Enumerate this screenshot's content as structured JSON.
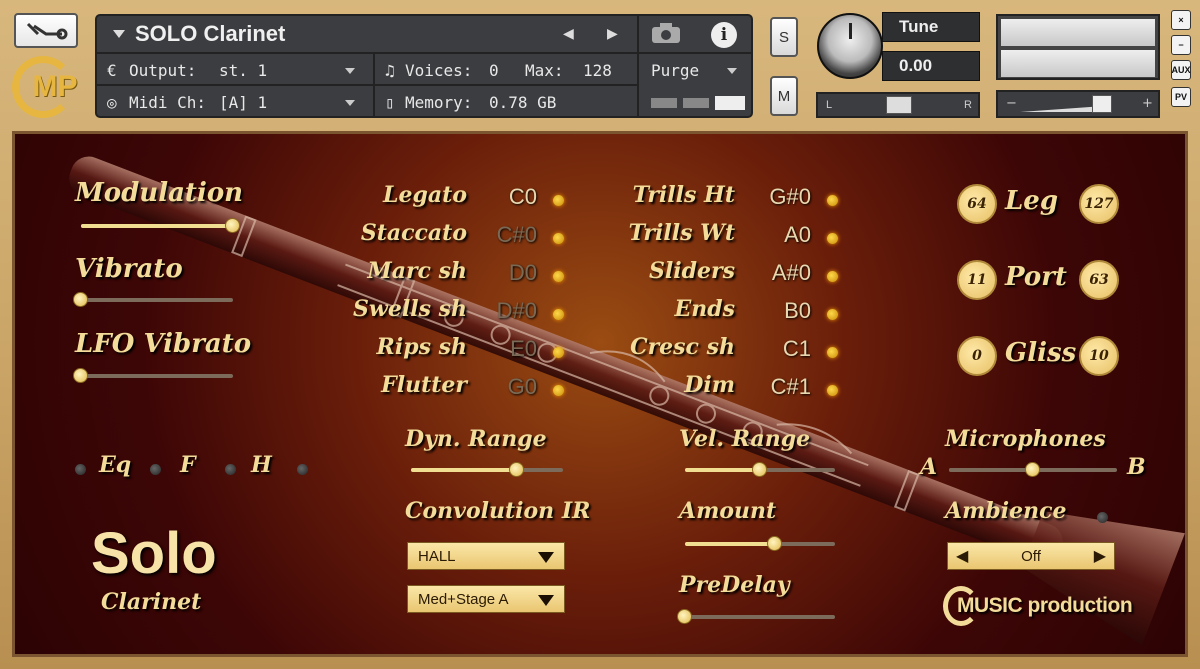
{
  "header": {
    "title": "SOLO Clarinet",
    "output_label": "Output:",
    "output_value": "st. 1",
    "voices_label": "Voices:",
    "voices_value": "0",
    "max_label": "Max:",
    "max_value": "128",
    "midi_label": "Midi Ch:",
    "midi_value": "[A] 1",
    "memory_label": "Memory:",
    "memory_value": "0.78 GB",
    "purge_label": "Purge",
    "s_label": "S",
    "m_label": "M",
    "tune_label": "Tune",
    "tune_value": "0.00",
    "pan_left": "L",
    "pan_right": "R",
    "vol_minus": "−",
    "vol_plus": "+",
    "side_buttons": [
      "×",
      "−",
      "AUX",
      "PV"
    ],
    "logo_text": "MP"
  },
  "controls": {
    "modulation": {
      "label": "Modulation",
      "value": 1.0
    },
    "vibrato": {
      "label": "Vibrato",
      "value": 0.0
    },
    "lfo_vibrato": {
      "label": "LFO Vibrato",
      "value": 0.0
    },
    "eq_labels": [
      "Eq",
      "F",
      "H"
    ],
    "dyn_range": {
      "label": "Dyn. Range",
      "value": 0.7
    },
    "vel_range": {
      "label": "Vel. Range",
      "value": 0.5
    },
    "convolution": {
      "label": "Convolution IR",
      "option1": "HALL",
      "option2": "Med+Stage A"
    },
    "amount": {
      "label": "Amount",
      "value": 0.6
    },
    "predelay": {
      "label": "PreDelay",
      "value": 0.0
    },
    "microphones": {
      "label": "Microphones",
      "a": "A",
      "b": "B",
      "value": 0.5
    },
    "ambience": {
      "label": "Ambience",
      "value": "Off"
    }
  },
  "keyswitches_left": [
    {
      "name": "Legato",
      "note": "C0"
    },
    {
      "name": "Staccato",
      "note": "C#0"
    },
    {
      "name": "Marc sh",
      "note": "D0"
    },
    {
      "name": "Swells sh",
      "note": "D#0"
    },
    {
      "name": "Rips sh",
      "note": "E0"
    },
    {
      "name": "Flutter",
      "note": "G0"
    }
  ],
  "keyswitches_right": [
    {
      "name": "Trills Ht",
      "note": "G#0"
    },
    {
      "name": "Trills Wt",
      "note": "A0"
    },
    {
      "name": "Sliders",
      "note": "A#0"
    },
    {
      "name": "Ends",
      "note": "B0"
    },
    {
      "name": "Cresc sh",
      "note": "C1"
    },
    {
      "name": "Dim",
      "note": "C#1"
    }
  ],
  "ranges": [
    {
      "label": "Leg",
      "low": "64",
      "high": "127"
    },
    {
      "label": "Port",
      "low": "11",
      "high": "63"
    },
    {
      "label": "Gliss",
      "low": "0",
      "high": "10"
    }
  ],
  "branding": {
    "product": "Solo",
    "product_sub": "Clarinet",
    "company": "MUSIC production"
  },
  "colors": {
    "gold": "#f3dc9a",
    "led": "#ffc21a",
    "background": "#3d0606"
  }
}
